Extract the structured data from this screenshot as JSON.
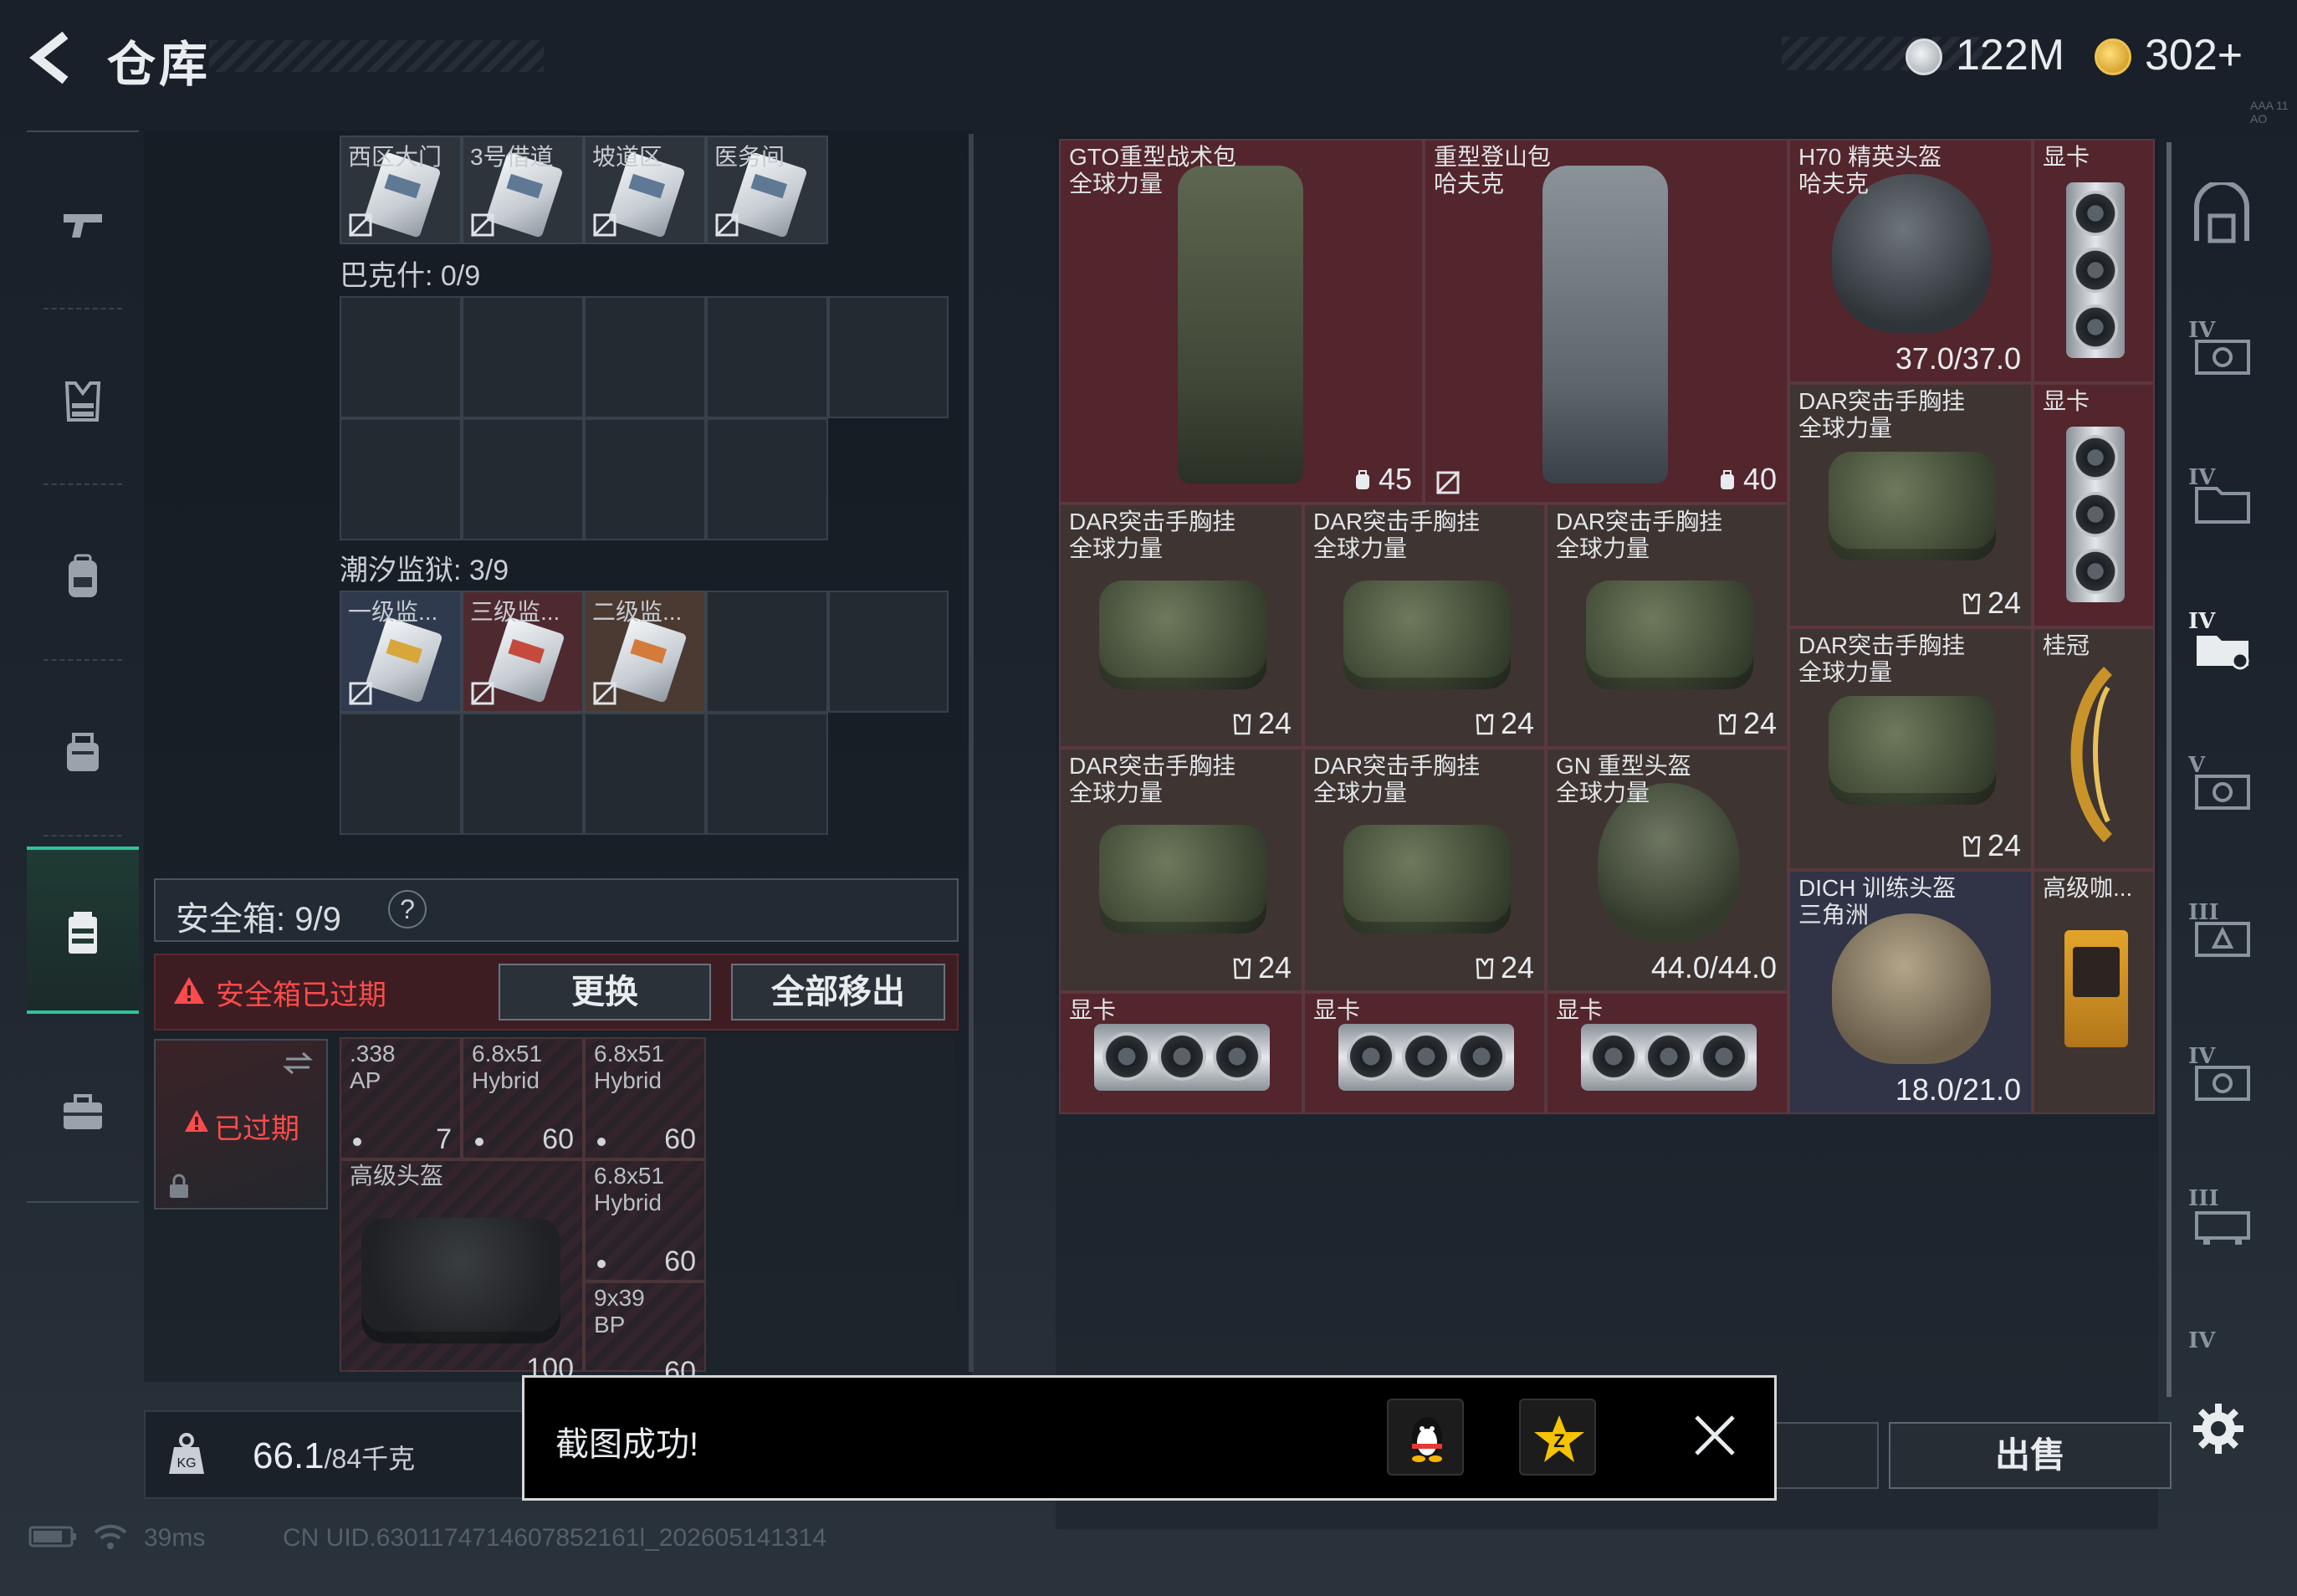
{
  "header": {
    "title": "仓库",
    "money": "122M",
    "coins": "302+",
    "tiny": "AAA 11 AO"
  },
  "sidebar": {
    "items": [
      {
        "icon": "pistol-icon"
      },
      {
        "icon": "body-armor-icon"
      },
      {
        "icon": "backpack-icon"
      },
      {
        "icon": "rig-icon"
      },
      {
        "icon": "safe-case-icon",
        "active": true
      },
      {
        "icon": "briefcase-icon"
      }
    ]
  },
  "keys": {
    "top_row": [
      "西区大门",
      "3号借道",
      "坡道区",
      "医务间"
    ],
    "bakesh": "巴克什: 0/9",
    "tidal": "潮汐监狱: 3/9",
    "tidal_items": [
      "一级监...",
      "三级监...",
      "二级监..."
    ]
  },
  "safe": {
    "label": "安全箱: 9/9",
    "help": "?",
    "expired_warning": "安全箱已过期",
    "replace": "更换",
    "move_all": "全部移出",
    "box_status": "已过期",
    "items": [
      {
        "name": ".338\nAP",
        "count": "7"
      },
      {
        "name": "6.8x51\nHybrid",
        "count": "60"
      },
      {
        "name": "6.8x51\nHybrid",
        "count": "60"
      },
      {
        "name": "高级头盔",
        "count": "100"
      },
      {
        "name": "6.8x51\nHybrid",
        "count": "60"
      },
      {
        "name": "9x39\nBP",
        "count": "60"
      }
    ]
  },
  "weight": {
    "value": "66.1",
    "max": "/84千克"
  },
  "storage": {
    "items": [
      {
        "name": "GTO重型战术包\n全球力量",
        "count": "45"
      },
      {
        "name": "重型登山包\n哈夫克",
        "count": "40"
      },
      {
        "name": "H70 精英头盔\n哈夫克",
        "count": "37.0/37.0"
      },
      {
        "name": "显卡",
        "count": ""
      },
      {
        "name": "DAR突击手胸挂\n全球力量",
        "count": "24"
      },
      {
        "name": "显卡",
        "count": ""
      },
      {
        "name": "DAR突击手胸挂\n全球力量",
        "count": "24"
      },
      {
        "name": "DAR突击手胸挂\n全球力量",
        "count": "24"
      },
      {
        "name": "DAR突击手胸挂\n全球力量",
        "count": "24"
      },
      {
        "name": "DAR突击手胸挂\n全球力量",
        "count": "24"
      },
      {
        "name": "桂冠",
        "count": ""
      },
      {
        "name": "DAR突击手胸挂\n全球力量",
        "count": "24"
      },
      {
        "name": "DAR突击手胸挂\n全球力量",
        "count": "24"
      },
      {
        "name": "GN 重型头盔\n全球力量",
        "count": "44.0/44.0"
      },
      {
        "name": "DICH 训练头盔\n三角洲",
        "count": "18.0/21.0"
      },
      {
        "name": "高级咖...",
        "count": ""
      },
      {
        "name": "显卡",
        "count": ""
      },
      {
        "name": "显卡",
        "count": ""
      },
      {
        "name": "显卡",
        "count": ""
      }
    ]
  },
  "rail": {
    "tiers": [
      "IV",
      "IV",
      "IV",
      "V",
      "III",
      "IV",
      "III",
      "IV"
    ]
  },
  "sell": "出售",
  "toast": {
    "text": "截图成功!"
  },
  "status": {
    "ping": "39ms",
    "uid": "CN UID.6301174714607852161l_202605141314"
  }
}
